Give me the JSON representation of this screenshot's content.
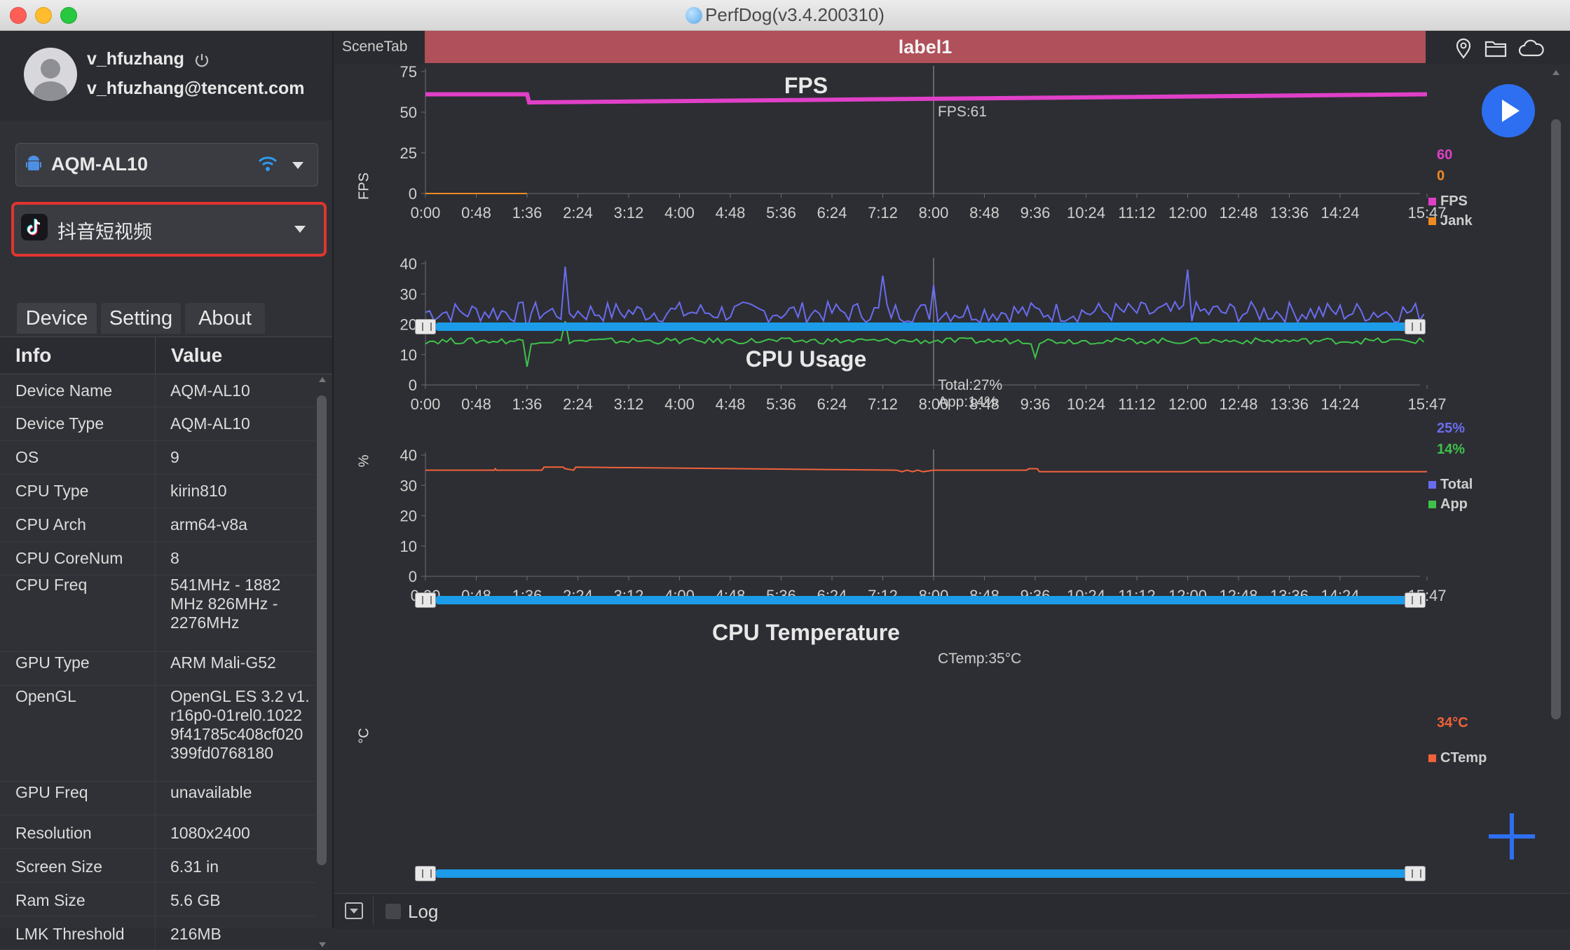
{
  "window": {
    "title": "PerfDog(v3.4.200310)"
  },
  "user": {
    "name": "v_hfuzhang",
    "email": "v_hfuzhang@tencent.com"
  },
  "device_select": {
    "value": "AQM-AL10"
  },
  "app_select": {
    "value": "抖音短视频"
  },
  "tabs": [
    "Device",
    "Setting",
    "About"
  ],
  "info_table": {
    "headers": [
      "Info",
      "Value"
    ],
    "rows": [
      {
        "k": "Device Name",
        "v": "AQM-AL10"
      },
      {
        "k": "Device Type",
        "v": "AQM-AL10"
      },
      {
        "k": "OS",
        "v": "9"
      },
      {
        "k": "CPU Type",
        "v": "kirin810"
      },
      {
        "k": "CPU Arch",
        "v": "arm64-v8a"
      },
      {
        "k": "CPU CoreNum",
        "v": "8"
      },
      {
        "k": "CPU Freq",
        "v": "541MHz - 1882MHz 826MHz - 2276MHz"
      },
      {
        "k": "GPU Type",
        "v": "ARM Mali-G52"
      },
      {
        "k": "OpenGL",
        "v": "OpenGL ES 3.2 v1.r16p0-01rel0.10229f41785c408cf020399fd0768180"
      },
      {
        "k": "GPU Freq",
        "v": "unavailable"
      },
      {
        "k": "Resolution",
        "v": "1080x2400"
      },
      {
        "k": "Screen Size",
        "v": "6.31 in"
      },
      {
        "k": "Ram Size",
        "v": "5.6 GB"
      },
      {
        "k": "LMK Threshold",
        "v": "216MB"
      }
    ]
  },
  "scene": {
    "tab_label": "SceneTab",
    "label": "label1"
  },
  "bottom": {
    "log_label": "Log"
  },
  "x_ticks": [
    "0:00",
    "0:48",
    "1:36",
    "2:24",
    "3:12",
    "4:00",
    "4:48",
    "5:36",
    "6:24",
    "7:12",
    "8:00",
    "8:48",
    "9:36",
    "10:24",
    "11:12",
    "12:00",
    "12:48",
    "13:36",
    "14:24",
    "15:47"
  ],
  "colors": {
    "fps": "#e040c8",
    "jank": "#f08a24",
    "total": "#6a6cf0",
    "app": "#3ec24a",
    "ctemp": "#f0623a",
    "accent": "#1c9ce8",
    "scene_label_bg": "#b0505a"
  },
  "chart_data": [
    {
      "type": "line",
      "title": "FPS",
      "ylabel": "FPS",
      "ylim": [
        0,
        75
      ],
      "yticks": [
        "75",
        "50",
        "25",
        "0"
      ],
      "cursor_x": "8:00",
      "cursor_text": "FPS:61",
      "series": [
        {
          "name": "FPS",
          "color": "#e040c8",
          "current": "60",
          "x": [
            "0:00",
            "1:36",
            "1:38",
            "15:47"
          ],
          "values": [
            61,
            61,
            56,
            61
          ]
        },
        {
          "name": "Jank",
          "color": "#f08a24",
          "current": "0",
          "x": [
            "0:00",
            "1:36"
          ],
          "values": [
            0,
            0
          ]
        }
      ]
    },
    {
      "type": "line",
      "title": "CPU Usage",
      "ylabel": "%",
      "ylim": [
        0,
        40
      ],
      "yticks": [
        "40",
        "30",
        "20",
        "10",
        "0"
      ],
      "cursor_x": "8:00",
      "cursor_text": [
        "Total:27%",
        "App:14%"
      ],
      "series": [
        {
          "name": "Total",
          "color": "#6a6cf0",
          "current": "25%",
          "baseline": 24,
          "noise": 3.5,
          "spikes": [
            {
              "x": "1:36",
              "v": 18
            },
            {
              "x": "2:10",
              "v": 39
            },
            {
              "x": "7:12",
              "v": 36
            },
            {
              "x": "8:00",
              "v": 33
            },
            {
              "x": "12:00",
              "v": 38
            }
          ]
        },
        {
          "name": "App",
          "color": "#3ec24a",
          "current": "14%",
          "baseline": 14.5,
          "noise": 1.0,
          "spikes": [
            {
              "x": "1:36",
              "v": 6
            },
            {
              "x": "2:10",
              "v": 21
            },
            {
              "x": "9:36",
              "v": 9
            }
          ]
        }
      ]
    },
    {
      "type": "line",
      "title": "CPU Temperature",
      "ylabel": "°C",
      "ylim": [
        0,
        40
      ],
      "yticks": [
        "40",
        "30",
        "20",
        "10",
        "0"
      ],
      "cursor_x": "8:00",
      "cursor_text": "CTemp:35°C",
      "series": [
        {
          "name": "CTemp",
          "color": "#f0623a",
          "current": "34°C",
          "x": [
            "0:00",
            "1:05",
            "1:06",
            "1:07",
            "1:50",
            "1:52",
            "2:10",
            "2:12",
            "2:20",
            "2:22",
            "7:25",
            "7:30",
            "7:35",
            "7:40",
            "7:45",
            "7:50",
            "8:00",
            "9:28",
            "9:30",
            "9:38",
            "9:40",
            "15:47"
          ],
          "values": [
            35,
            35,
            35.5,
            35,
            35,
            36,
            36,
            35.5,
            35,
            36,
            35,
            34.5,
            35,
            34.5,
            35,
            34.5,
            35,
            35,
            35.5,
            35.5,
            34.5,
            34.5
          ]
        }
      ]
    }
  ]
}
